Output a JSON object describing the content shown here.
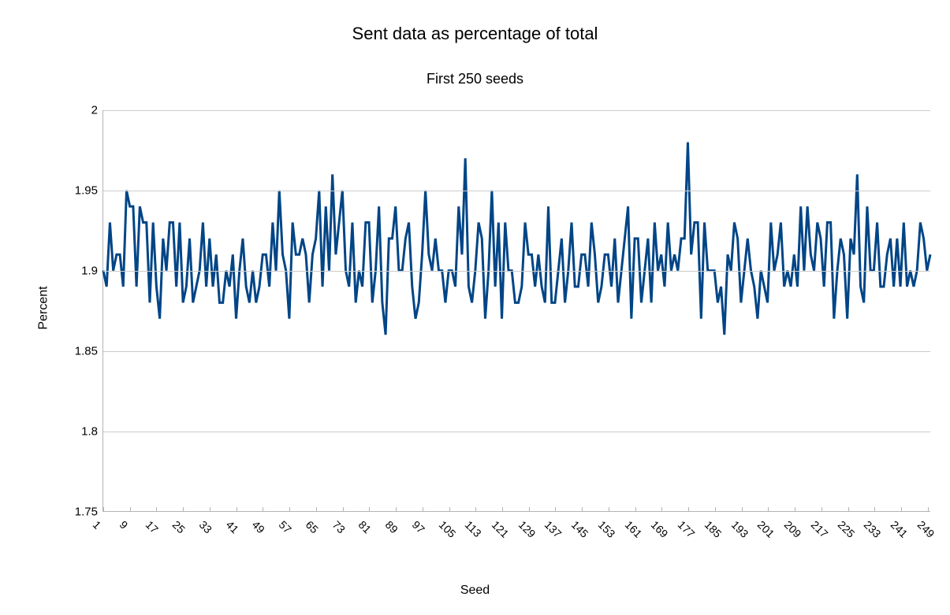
{
  "chart_data": {
    "type": "line",
    "title": "Sent data as percentage of total",
    "subtitle": "First 250 seeds",
    "xlabel": "Seed",
    "ylabel": "Percent",
    "ylim": [
      1.75,
      2.0
    ],
    "yticks": [
      1.75,
      1.8,
      1.85,
      1.9,
      1.95,
      2.0
    ],
    "xticks": [
      1,
      9,
      17,
      25,
      33,
      41,
      49,
      57,
      65,
      73,
      81,
      89,
      97,
      105,
      113,
      121,
      129,
      137,
      145,
      153,
      161,
      169,
      177,
      185,
      193,
      201,
      209,
      217,
      225,
      233,
      241,
      249
    ],
    "line_color": "#004586",
    "x": [
      1,
      2,
      3,
      4,
      5,
      6,
      7,
      8,
      9,
      10,
      11,
      12,
      13,
      14,
      15,
      16,
      17,
      18,
      19,
      20,
      21,
      22,
      23,
      24,
      25,
      26,
      27,
      28,
      29,
      30,
      31,
      32,
      33,
      34,
      35,
      36,
      37,
      38,
      39,
      40,
      41,
      42,
      43,
      44,
      45,
      46,
      47,
      48,
      49,
      50,
      51,
      52,
      53,
      54,
      55,
      56,
      57,
      58,
      59,
      60,
      61,
      62,
      63,
      64,
      65,
      66,
      67,
      68,
      69,
      70,
      71,
      72,
      73,
      74,
      75,
      76,
      77,
      78,
      79,
      80,
      81,
      82,
      83,
      84,
      85,
      86,
      87,
      88,
      89,
      90,
      91,
      92,
      93,
      94,
      95,
      96,
      97,
      98,
      99,
      100,
      101,
      102,
      103,
      104,
      105,
      106,
      107,
      108,
      109,
      110,
      111,
      112,
      113,
      114,
      115,
      116,
      117,
      118,
      119,
      120,
      121,
      122,
      123,
      124,
      125,
      126,
      127,
      128,
      129,
      130,
      131,
      132,
      133,
      134,
      135,
      136,
      137,
      138,
      139,
      140,
      141,
      142,
      143,
      144,
      145,
      146,
      147,
      148,
      149,
      150,
      151,
      152,
      153,
      154,
      155,
      156,
      157,
      158,
      159,
      160,
      161,
      162,
      163,
      164,
      165,
      166,
      167,
      168,
      169,
      170,
      171,
      172,
      173,
      174,
      175,
      176,
      177,
      178,
      179,
      180,
      181,
      182,
      183,
      184,
      185,
      186,
      187,
      188,
      189,
      190,
      191,
      192,
      193,
      194,
      195,
      196,
      197,
      198,
      199,
      200,
      201,
      202,
      203,
      204,
      205,
      206,
      207,
      208,
      209,
      210,
      211,
      212,
      213,
      214,
      215,
      216,
      217,
      218,
      219,
      220,
      221,
      222,
      223,
      224,
      225,
      226,
      227,
      228,
      229,
      230,
      231,
      232,
      233,
      234,
      235,
      236,
      237,
      238,
      239,
      240,
      241,
      242,
      243,
      244,
      245,
      246,
      247,
      248,
      249,
      250
    ],
    "values": [
      1.9,
      1.89,
      1.93,
      1.9,
      1.91,
      1.91,
      1.89,
      1.95,
      1.94,
      1.94,
      1.89,
      1.94,
      1.93,
      1.93,
      1.88,
      1.93,
      1.89,
      1.87,
      1.92,
      1.9,
      1.93,
      1.93,
      1.89,
      1.93,
      1.88,
      1.89,
      1.92,
      1.88,
      1.89,
      1.9,
      1.93,
      1.89,
      1.92,
      1.89,
      1.91,
      1.88,
      1.88,
      1.9,
      1.89,
      1.91,
      1.87,
      1.9,
      1.92,
      1.89,
      1.88,
      1.9,
      1.88,
      1.89,
      1.91,
      1.91,
      1.89,
      1.93,
      1.9,
      1.95,
      1.91,
      1.9,
      1.87,
      1.93,
      1.91,
      1.91,
      1.92,
      1.91,
      1.88,
      1.91,
      1.92,
      1.95,
      1.89,
      1.94,
      1.9,
      1.96,
      1.91,
      1.93,
      1.95,
      1.9,
      1.89,
      1.93,
      1.88,
      1.9,
      1.89,
      1.93,
      1.93,
      1.88,
      1.9,
      1.94,
      1.88,
      1.86,
      1.92,
      1.92,
      1.94,
      1.9,
      1.9,
      1.92,
      1.93,
      1.89,
      1.87,
      1.88,
      1.91,
      1.95,
      1.91,
      1.9,
      1.92,
      1.9,
      1.9,
      1.88,
      1.9,
      1.9,
      1.89,
      1.94,
      1.91,
      1.97,
      1.89,
      1.88,
      1.9,
      1.93,
      1.92,
      1.87,
      1.9,
      1.95,
      1.89,
      1.93,
      1.87,
      1.93,
      1.9,
      1.9,
      1.88,
      1.88,
      1.89,
      1.93,
      1.91,
      1.91,
      1.89,
      1.91,
      1.89,
      1.88,
      1.94,
      1.88,
      1.88,
      1.9,
      1.92,
      1.88,
      1.9,
      1.93,
      1.89,
      1.89,
      1.91,
      1.91,
      1.89,
      1.93,
      1.91,
      1.88,
      1.89,
      1.91,
      1.91,
      1.89,
      1.92,
      1.88,
      1.9,
      1.92,
      1.94,
      1.87,
      1.92,
      1.92,
      1.88,
      1.9,
      1.92,
      1.88,
      1.93,
      1.9,
      1.91,
      1.89,
      1.93,
      1.9,
      1.91,
      1.9,
      1.92,
      1.92,
      1.98,
      1.91,
      1.93,
      1.93,
      1.87,
      1.93,
      1.9,
      1.9,
      1.9,
      1.88,
      1.89,
      1.86,
      1.91,
      1.9,
      1.93,
      1.92,
      1.88,
      1.9,
      1.92,
      1.9,
      1.89,
      1.87,
      1.9,
      1.89,
      1.88,
      1.93,
      1.9,
      1.91,
      1.93,
      1.89,
      1.9,
      1.89,
      1.91,
      1.89,
      1.94,
      1.9,
      1.94,
      1.91,
      1.9,
      1.93,
      1.92,
      1.89,
      1.93,
      1.93,
      1.87,
      1.9,
      1.92,
      1.91,
      1.87,
      1.92,
      1.91,
      1.96,
      1.89,
      1.88,
      1.94,
      1.9,
      1.9,
      1.93,
      1.89,
      1.89,
      1.91,
      1.92,
      1.89,
      1.92,
      1.89,
      1.93,
      1.89,
      1.9,
      1.89,
      1.9,
      1.93,
      1.92,
      1.9,
      1.91
    ]
  }
}
